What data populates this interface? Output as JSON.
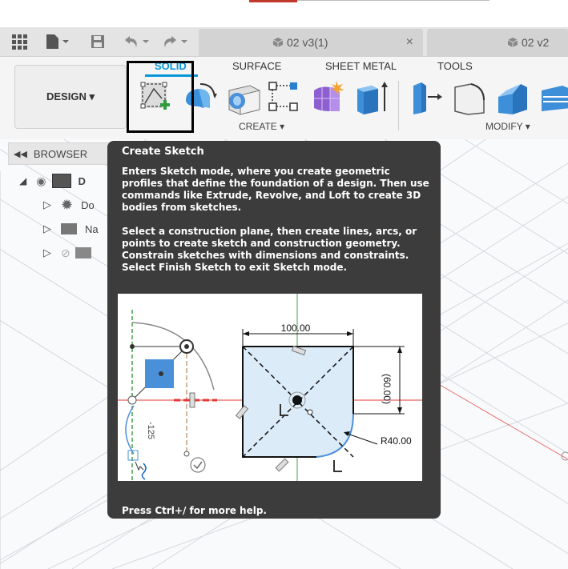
{
  "toolbar": {
    "tabs": [
      {
        "label": "02 v3(1)",
        "close": "×"
      },
      {
        "label": "02 v2"
      }
    ]
  },
  "ribbon": {
    "workspace": "DESIGN ▾",
    "tabs": [
      "SOLID",
      "SURFACE",
      "SHEET METAL",
      "TOOLS"
    ],
    "groups": [
      "CREATE ▾",
      "MODIFY ▾"
    ]
  },
  "browser": {
    "title": "BROWSER",
    "rows": [
      "D",
      "Do",
      "Na"
    ]
  },
  "tooltip": {
    "title": "Create Sketch",
    "para1": "Enters Sketch mode, where you create geometric profiles that define the foundation of a design. Then use commands like Extrude, Revolve, and Loft to create 3D bodies from sketches.",
    "para2": "Select a construction plane, then create lines, arcs, or points to create sketch and construction geometry. Constrain sketches with dimensions and constraints. Select Finish Sketch to exit Sketch mode.",
    "help": "Press Ctrl+/ for more help.",
    "diagram": {
      "dim_width": "100.00",
      "dim_height": "(60.00)",
      "dim_radius": "R40.00",
      "dim_side": "-125"
    }
  },
  "colors": {
    "accent": "#0696d7",
    "highlight_border": "#000000",
    "tooltip_bg": "#3c3c3c"
  }
}
